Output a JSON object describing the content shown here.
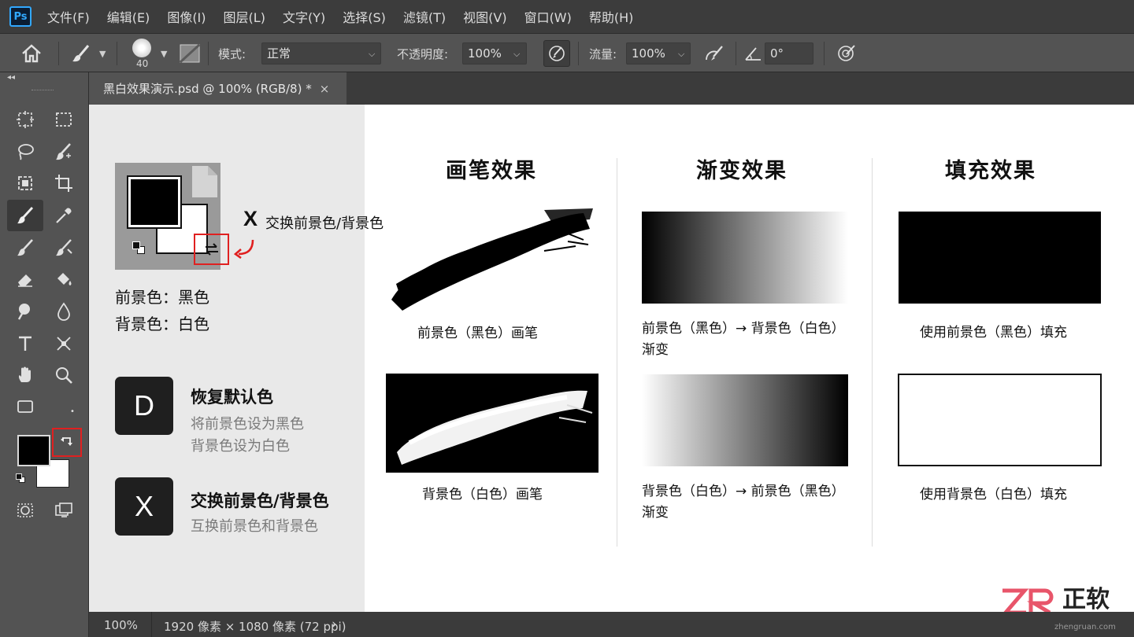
{
  "app": {
    "logo": "Ps"
  },
  "menu": [
    "文件(F)",
    "编辑(E)",
    "图像(I)",
    "图层(L)",
    "文字(Y)",
    "选择(S)",
    "滤镜(T)",
    "视图(V)",
    "窗口(W)",
    "帮助(H)"
  ],
  "options": {
    "brush_size": "40",
    "mode_label": "模式:",
    "mode_value": "正常",
    "opacity_label": "不透明度:",
    "opacity_value": "100%",
    "flow_label": "流量:",
    "flow_value": "100%",
    "angle_value": "0°"
  },
  "tab": {
    "title": "黑白效果演示.psd @ 100% (RGB/8) *",
    "close": "×"
  },
  "canvas": {
    "swatch_annotation_key": "X",
    "swatch_annotation_text": "交换前景色/背景色",
    "fg_line": "前景色：黑色",
    "bg_line": "背景色：白色",
    "key_d": {
      "key": "D",
      "title": "恢复默认色",
      "desc1": "将前景色设为黑色",
      "desc2": "背景色设为白色"
    },
    "key_x": {
      "key": "X",
      "title": "交换前景色/背景色",
      "desc1": "互换前景色和背景色"
    },
    "sections": {
      "brush": {
        "title": "画笔效果",
        "caption_top": "前景色（黑色）画笔",
        "caption_bottom": "背景色（白色）画笔"
      },
      "gradient": {
        "title": "渐变效果",
        "caption_top_1": "前景色（黑色）→ 背景色（白色）",
        "caption_top_2": "渐变",
        "caption_bottom_1": "背景色（白色）→ 前景色（黑色）",
        "caption_bottom_2": "渐变"
      },
      "fill": {
        "title": "填充效果",
        "caption_top": "使用前景色（黑色）填充",
        "caption_bottom": "使用背景色（白色）填充"
      }
    }
  },
  "status": {
    "zoom": "100%",
    "doc_info": "1920 像素 × 1080 像素 (72 ppi)",
    "arrow": "›"
  },
  "watermark": {
    "brand": "正软",
    "sub": "zhengruan.com"
  },
  "colors": {
    "accent_red": "#e02020",
    "ps_blue": "#31a8ff"
  }
}
